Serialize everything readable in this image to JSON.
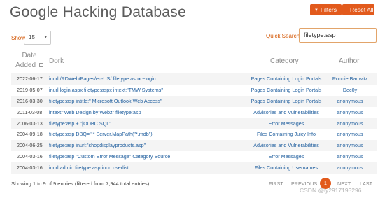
{
  "header": {
    "title": "Google Hacking Database",
    "filters_label": "Filters",
    "reset_label": "Reset All"
  },
  "controls": {
    "show_label": "Show",
    "show_value": "15",
    "quick_search_label": "Quick Search",
    "quick_search_value": "filetype:asp"
  },
  "table": {
    "headers": {
      "date": "Date Added",
      "dork": "Dork",
      "category": "Category",
      "author": "Author"
    },
    "rows": [
      {
        "date": "2022-06-17",
        "dork": "inurl:/RDWeb/Pages/en-US/ filetype:aspx ~login",
        "category": "Pages Containing Login Portals",
        "author": "Ronnie Bartwitz"
      },
      {
        "date": "2019-05-07",
        "dork": "inurl:login.aspx filetype:aspx intext:\"TMW Systems\"",
        "category": "Pages Containing Login Portals",
        "author": "Dec0y"
      },
      {
        "date": "2016-03-30",
        "dork": "filetype:asp intitle:\" Microsoft Outlook Web Access\"",
        "category": "Pages Containing Login Portals",
        "author": "anonymous"
      },
      {
        "date": "2011-03-08",
        "dork": "intext:\"Web Design by Webz\" filetype:asp",
        "category": "Advisories and Vulnerabilities",
        "author": "anonymous"
      },
      {
        "date": "2006-03-13",
        "dork": "filetype:asp + \"[ODBC SQL\"",
        "category": "Error Messages",
        "author": "anonymous"
      },
      {
        "date": "2004-09-18",
        "dork": "filetype:asp DBQ=\" * Server.MapPath(\"*.mdb\")",
        "category": "Files Containing Juicy Info",
        "author": "anonymous"
      },
      {
        "date": "2004-06-25",
        "dork": "filetype:asp inurl:\"shopdisplayproducts.asp\"",
        "category": "Advisories and Vulnerabilities",
        "author": "anonymous"
      },
      {
        "date": "2004-03-16",
        "dork": "filetype:asp \"Custom Error Message\" Category Source",
        "category": "Error Messages",
        "author": "anonymous"
      },
      {
        "date": "2004-03-16",
        "dork": "inurl:admin filetype:asp inurl:userlist",
        "category": "Files Containing Usernames",
        "author": "anonymous"
      }
    ]
  },
  "footer": {
    "info": "Showing 1 to 9 of 9 entries (filtered from 7,944 total entries)",
    "first": "FIRST",
    "previous": "PREVIOUS",
    "current_page": "1",
    "next": "NEXT",
    "last": "LAST"
  },
  "watermark": "CSDN @ly2917193296",
  "colors": {
    "accent": "#e25a1c",
    "link": "#1f5e9e"
  },
  "icons": {
    "filter": "filter-icon",
    "reset": "reset-icon",
    "sort": "sort-icon"
  }
}
